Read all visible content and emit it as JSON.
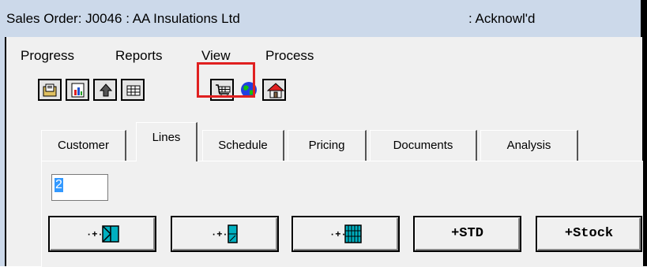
{
  "window": {
    "title_left": "Sales Order: J0046   : AA Insulations Ltd",
    "title_right": ": Acknowl'd"
  },
  "menu": [
    {
      "label": "Progress"
    },
    {
      "label": "Reports"
    },
    {
      "label": "View"
    },
    {
      "label": "Process"
    }
  ],
  "toolbar": [
    {
      "icon": "open-folder-icon"
    },
    {
      "icon": "chart-document-icon"
    },
    {
      "icon": "up-arrow-icon"
    },
    {
      "icon": "grid-table-icon"
    },
    {
      "icon": "shopping-cart-icon",
      "highlighted": true
    },
    {
      "icon": "globe-icon"
    },
    {
      "icon": "house-icon"
    }
  ],
  "tabs": [
    {
      "label": "Customer"
    },
    {
      "label": "Lines",
      "active": true
    },
    {
      "label": "Schedule"
    },
    {
      "label": "Pricing"
    },
    {
      "label": "Documents"
    },
    {
      "label": "Analysis"
    }
  ],
  "lines_panel": {
    "quantity_value": "2",
    "buttons": [
      {
        "label": "",
        "icon": "add-panel-icon"
      },
      {
        "label": "",
        "icon": "add-door-icon"
      },
      {
        "label": "",
        "icon": "add-grid-panel-icon"
      },
      {
        "label": "+STD"
      },
      {
        "label": "+Stock"
      }
    ]
  },
  "colors": {
    "titlebar": "#ccd9ea",
    "highlight": "#e02020",
    "selection": "#3399ff",
    "icon_cyan": "#00b0c0"
  }
}
